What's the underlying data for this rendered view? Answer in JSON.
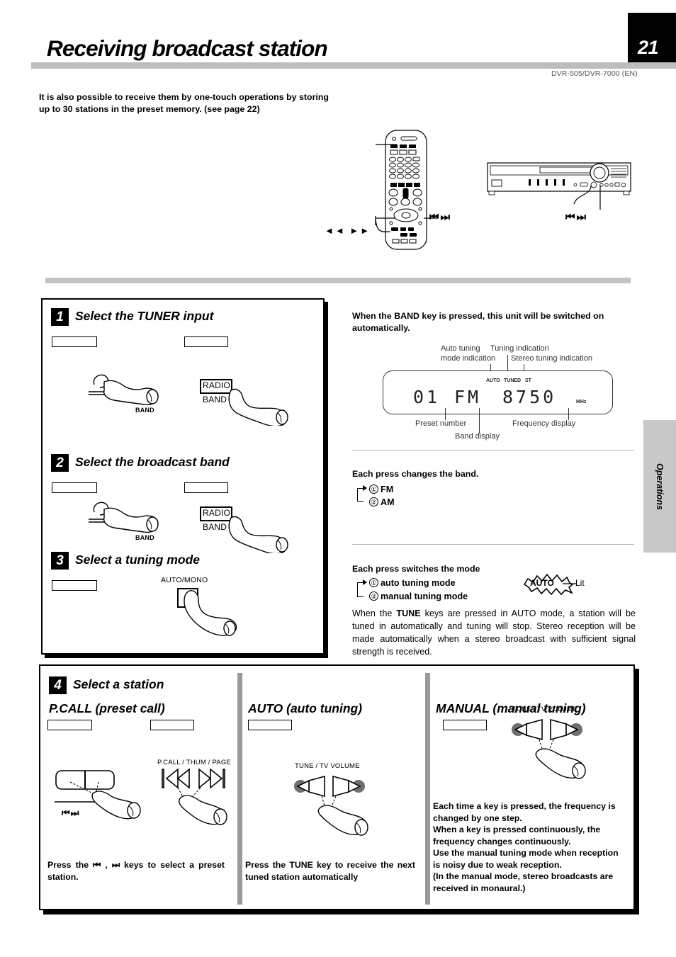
{
  "header": {
    "title": "Receiving broadcast station",
    "page_number": "21",
    "model_code": "DVR-505/DVR-7000 (EN)",
    "intro": "It is also possible to receive them by one-touch operations by storing up to 30 stations in the preset memory. (see page 22)"
  },
  "side_tab": {
    "label": "Operations"
  },
  "top_illustration": {
    "remote_arrows_left": "◄◄  ►►",
    "remote_arrows_right": "⏮⏭",
    "remote_skip_keys": "◄◄  ►►",
    "unit_skip_keys": "⏮⏭"
  },
  "steps": [
    {
      "number": "1",
      "heading": "Select the TUNER input",
      "left_label": "",
      "right_label": "",
      "unit_key_label": "BAND",
      "remote_key_line1": "RADIO",
      "remote_key_line2": "BAND"
    },
    {
      "number": "2",
      "heading": "Select the broadcast band",
      "left_label": "",
      "right_label": "",
      "unit_key_label": "BAND",
      "remote_key_line1": "RADIO",
      "remote_key_line2": "BAND"
    },
    {
      "number": "3",
      "heading": "Select a tuning mode",
      "left_label": "",
      "remote_key_label": "AUTO/MONO"
    }
  ],
  "band_section": {
    "note": "When the BAND key is pressed, this unit will be switched on automatically.",
    "display_callouts": {
      "auto_tuning": "Auto tuning\nmode indication",
      "auto_tuning_line1": "Auto tuning",
      "auto_tuning_line2": "mode indication",
      "tuning_indication": "Tuning indication",
      "stereo_tuning_indication": "Stereo tuning indication",
      "preset_number": "Preset number",
      "band_display": "Band display",
      "frequency_display": "Frequency display"
    },
    "display_readout": {
      "preset": "01",
      "band": "FM",
      "frequency": "8750",
      "unit": "MHz",
      "indicator_auto": "AUTO",
      "indicator_tuned": "TUNED",
      "indicator_stereo": "ST"
    },
    "band_cycle_title": "Each press changes the band.",
    "band_cycle": [
      {
        "num": "①",
        "label": "FM"
      },
      {
        "num": "②",
        "label": "AM"
      }
    ]
  },
  "mode_section": {
    "title": "Each press switches the mode",
    "mode_cycle": [
      {
        "num": "①",
        "label": "auto tuning mode"
      },
      {
        "num": "②",
        "label": "manual tuning mode"
      }
    ],
    "indicator_badge": "AUTO",
    "indicator_state": "Lit",
    "paragraph_pre": "When the ",
    "paragraph_bold": "TUNE",
    "paragraph_post": " keys are pressed in AUTO mode, a station will be tuned in automatically and tuning will stop. Stereo reception will be made automatically when a stereo broadcast with sufficient signal strength is received."
  },
  "step4": {
    "number": "4",
    "heading": "Select a station",
    "columns": [
      {
        "title": "P.CALL (preset call)",
        "label_left": "",
        "label_right": "",
        "unit_keys": "⏮⏭",
        "remote_key_label": "P.CALL / THUM / PAGE",
        "description": "Press the ⏮ , ⏭ keys to select a preset station."
      },
      {
        "title": "AUTO (auto tuning)",
        "label_left": "",
        "remote_key_label": "TUNE / TV VOLUME",
        "description": "Press the TUNE key to receive the next tuned station automatically"
      },
      {
        "title": "MANUAL (manual tuning)",
        "label_left": "",
        "remote_key_label": "TUNE / TV VOLUME",
        "description": "Each time a key is pressed, the frequency is changed by one step.\nWhen a key is pressed continuously, the frequency changes continuously.\nUse the manual tuning mode when reception is noisy due to weak reception.\n(In the manual mode, stereo broadcasts are received in monaural.)"
      }
    ]
  },
  "colors": {
    "rule_gray": "#c3c3c3",
    "tab_gray": "#c8c8c8",
    "black": "#000000"
  }
}
